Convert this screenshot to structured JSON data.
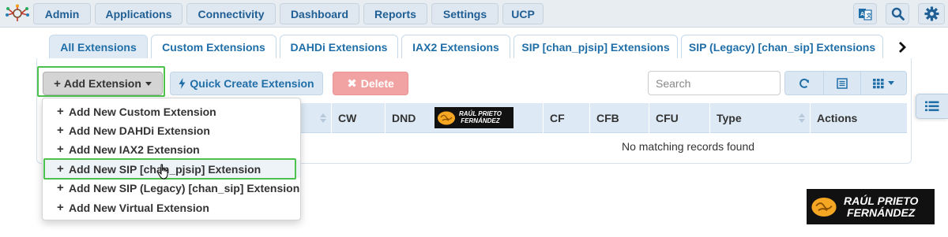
{
  "topnav": {
    "items": [
      "Admin",
      "Applications",
      "Connectivity",
      "Dashboard",
      "Reports",
      "Settings",
      "UCP"
    ]
  },
  "tabs": [
    {
      "label": "All Extensions",
      "active": true
    },
    {
      "label": "Custom Extensions"
    },
    {
      "label": "DAHDi Extensions"
    },
    {
      "label": "IAX2 Extensions"
    },
    {
      "label": "SIP [chan_pjsip] Extensions"
    },
    {
      "label": "SIP (Legacy) [chan_sip] Extensions"
    }
  ],
  "toolbar": {
    "add_label": "Add Extension",
    "quick_label": "Quick Create Extension",
    "delete_label": "Delete",
    "search_placeholder": "Search"
  },
  "table": {
    "columns": [
      "CW",
      "DND",
      "CF",
      "CFB",
      "CFU",
      "Type",
      "Actions"
    ],
    "empty_message": "No matching records found"
  },
  "dropdown": {
    "items": [
      "Add New Custom Extension",
      "Add New DAHDi Extension",
      "Add New IAX2 Extension",
      "Add New SIP [chan_pjsip] Extension",
      "Add New SIP (Legacy) [chan_sip] Extension",
      "Add New Virtual Extension"
    ],
    "hovered_index": 3
  },
  "watermark": {
    "line1": "RAÚL PRIETO",
    "line2": "FERNÁNDEZ"
  },
  "colors": {
    "accent_blue": "#1f6ea8",
    "highlight_green": "#4cc24c",
    "delete_red": "#f1a3a3"
  }
}
